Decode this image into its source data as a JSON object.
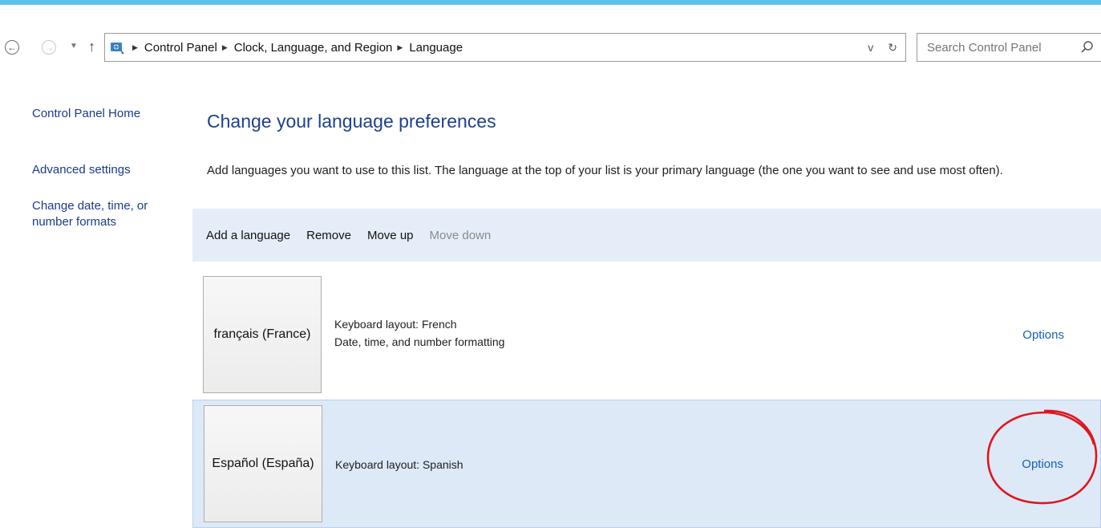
{
  "nav": {
    "back_icon": "back-arrow-icon",
    "forward_icon": "forward-arrow-icon",
    "recent_icon": "chevron-down-icon",
    "up_icon": "up-arrow-icon",
    "location_icon": "control-panel-icon",
    "breadcrumbs": [
      "Control Panel",
      "Clock, Language, and Region",
      "Language"
    ],
    "dropdown_glyph": "v",
    "refresh_glyph": "↻",
    "search_placeholder": "Search Control Panel",
    "search_icon": "search-icon"
  },
  "sidebar": {
    "items": [
      "Control Panel Home",
      "Advanced settings",
      "Change date, time, or number formats"
    ]
  },
  "main": {
    "title": "Change your language preferences",
    "description": "Add languages you want to use to this list. The language at the top of your list is your primary language (the one you want to see and use most often).",
    "toolbar": {
      "add": "Add a language",
      "remove": "Remove",
      "move_up": "Move up",
      "move_down": "Move down"
    },
    "languages": [
      {
        "name": "français (France)",
        "details": [
          "Keyboard layout: French",
          "Date, time, and number formatting"
        ],
        "options": "Options",
        "selected": false
      },
      {
        "name": "Español (España)",
        "details": [
          "Keyboard layout: Spanish"
        ],
        "options": "Options",
        "selected": true
      }
    ]
  },
  "colors": {
    "accent_bar": "#5bc2e7",
    "link": "#1a5fb4",
    "title": "#1e3f8f",
    "selection": "#dde9f7",
    "annotation": "#e0141c"
  }
}
